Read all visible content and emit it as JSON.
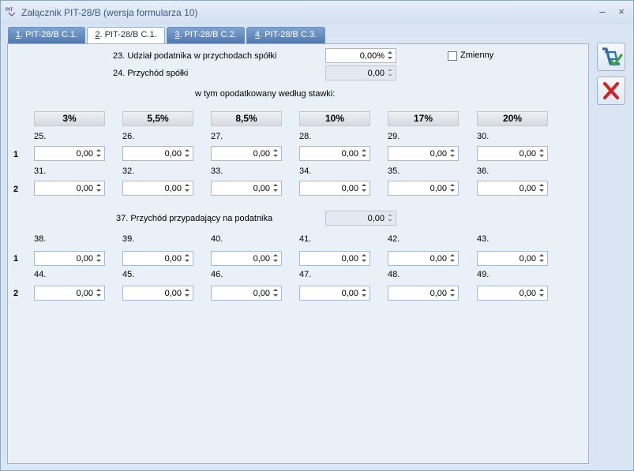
{
  "window": {
    "title": "Załącznik PIT-28/B (wersja formularza 10)",
    "minimize": "–",
    "close": "×"
  },
  "tabs": [
    {
      "key": "1",
      "label": ". PIT-28/B C.1."
    },
    {
      "key": "2",
      "label": ". PIT-28/B C.1."
    },
    {
      "key": "3",
      "label": ". PIT-28/B C.2."
    },
    {
      "key": "4",
      "label": ". PIT-28/B C.3."
    }
  ],
  "form": {
    "udzial_label": "23. Udział podatnika w przychodach spółki",
    "udzial_value": "0,00%",
    "zmienny_label": "Zmienny",
    "przychod_label": "24. Przychód spółki",
    "przychod_value": "0,00",
    "opodatkowany_label": "w tym opodatkowany według stawki:",
    "rates": [
      "3%",
      "5,5%",
      "8,5%",
      "10%",
      "17%",
      "20%"
    ],
    "row_labels": [
      "1",
      "2"
    ],
    "section1": {
      "row1_nums": [
        "25.",
        "26.",
        "27.",
        "28.",
        "29.",
        "30."
      ],
      "row1_vals": [
        "0,00",
        "0,00",
        "0,00",
        "0,00",
        "0,00",
        "0,00"
      ],
      "row2_nums": [
        "31.",
        "32.",
        "33.",
        "34.",
        "35.",
        "36."
      ],
      "row2_vals": [
        "0,00",
        "0,00",
        "0,00",
        "0,00",
        "0,00",
        "0,00"
      ]
    },
    "przypadajacy_label": "37. Przychód przypadający na podatnika",
    "przypadajacy_value": "0,00",
    "section2": {
      "row1_nums": [
        "38.",
        "39.",
        "40.",
        "41.",
        "42.",
        "43."
      ],
      "row1_vals": [
        "0,00",
        "0,00",
        "0,00",
        "0,00",
        "0,00",
        "0,00"
      ],
      "row2_nums": [
        "44.",
        "45.",
        "46.",
        "47.",
        "48.",
        "49."
      ],
      "row2_vals": [
        "0,00",
        "0,00",
        "0,00",
        "0,00",
        "0,00",
        "0,00"
      ]
    }
  },
  "colors": {
    "tab_active": "#ffffff",
    "tab_inactive": "#5a82b8",
    "save_icon": "#2e6db5",
    "cancel_icon": "#d42020"
  }
}
